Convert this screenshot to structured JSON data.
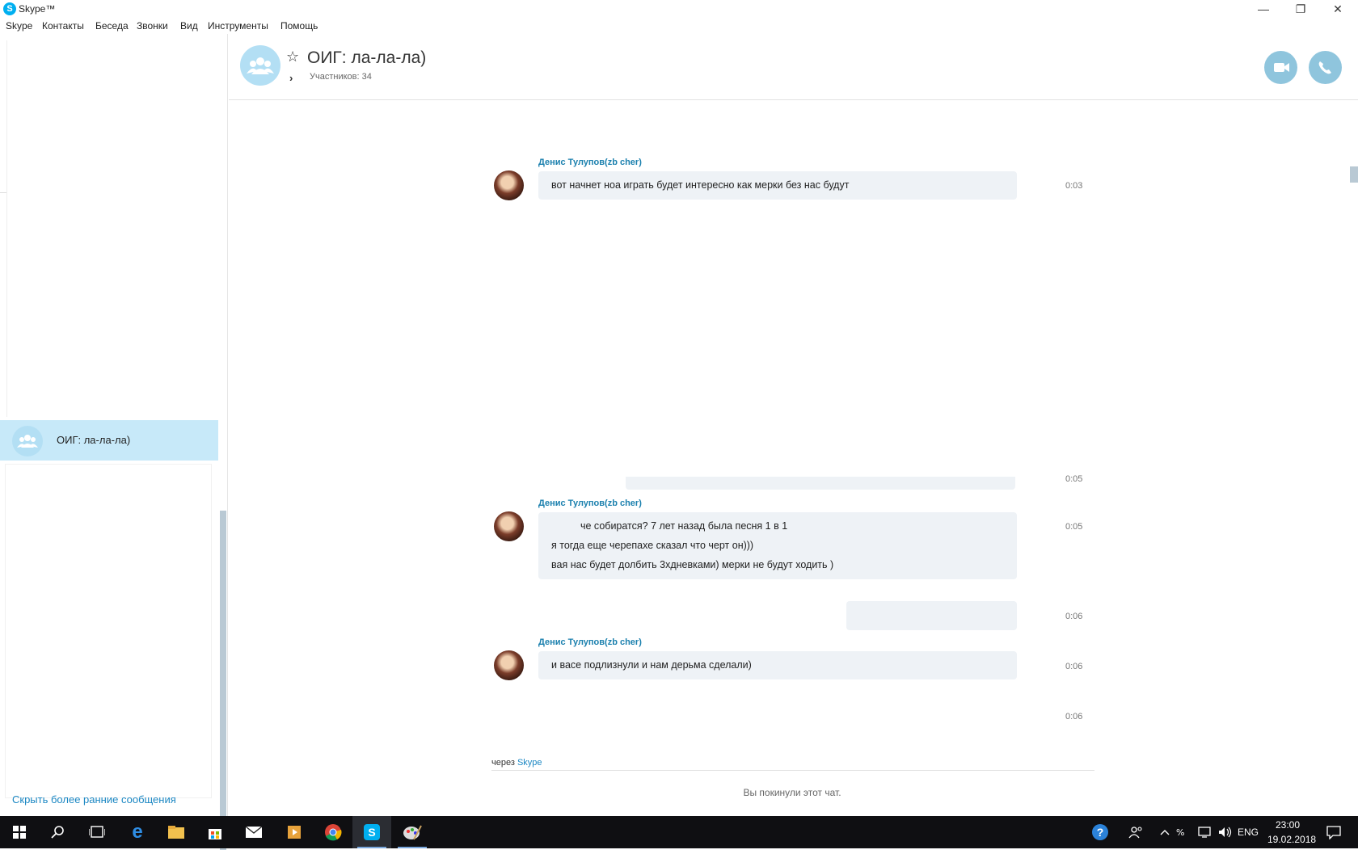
{
  "window": {
    "title": "Skype™",
    "logo": "S",
    "controls": {
      "minimize": "—",
      "restore": "❐",
      "close": "✕"
    }
  },
  "menu": [
    "Skype",
    "Контакты",
    "Беседа",
    "Звонки",
    "Вид",
    "Инструменты",
    "Помощь"
  ],
  "sidebar": {
    "active_conversation": "ОИГ: ла-ла-ла)",
    "hide_earlier": "Скрыть более ранние сообщения"
  },
  "header": {
    "title": "ОИГ: ла-ла-ла)",
    "members": "Участников: 34",
    "star_icon": "☆",
    "chevron_icon": "›"
  },
  "messages": [
    {
      "sender": "Денис Тулупов(zb cher)",
      "lines": [
        "вот начнет ноа играть будет интересно как мерки без нас будут"
      ],
      "time": "0:03"
    },
    {
      "partial_time": "0:05"
    },
    {
      "sender": "Денис Тулупов(zb cher)",
      "lines": [
        "че собиратся? 7 лет назад была песня 1 в 1",
        "я тогда еще черепахе сказал что черт он)))",
        "вая нас будет долбить 3хдневками) мерки не будут ходить )"
      ],
      "time": "0:05"
    },
    {
      "time": "0:06"
    },
    {
      "sender": "Денис Тулупов(zb cher)",
      "lines": [
        "и васе подлизнули и нам дерьма сделали)"
      ],
      "time": "0:06"
    },
    {
      "time": "0:06"
    }
  ],
  "footer": {
    "via_text": "через",
    "via_link": "Skype",
    "left_chat": "Вы покинули этот чат."
  },
  "taskbar": {
    "icons": [
      "windows-icon",
      "search-icon",
      "task-view-icon",
      "edge-icon",
      "explorer-icon",
      "store-icon",
      "mail-icon",
      "media-icon",
      "chrome-icon",
      "skype-icon",
      "paint-icon"
    ],
    "tray": {
      "language": "ENG",
      "time": "23:00",
      "date": "19.02.2018"
    }
  },
  "colors": {
    "accent": "#00aff0",
    "link": "#1b87c3",
    "bubble": "#eef2f6",
    "selected": "#c7e9f9"
  }
}
